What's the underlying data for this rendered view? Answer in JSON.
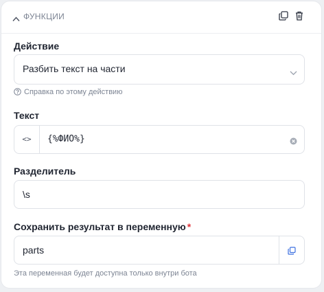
{
  "section": {
    "title": "ФУНКЦИИ"
  },
  "action": {
    "label": "Действие",
    "value": "Разбить текст на части",
    "help": "Справка по этому действию"
  },
  "text": {
    "label": "Текст",
    "code_toggle": "<>",
    "value": "{%ФИО%}"
  },
  "separator": {
    "label": "Разделитель",
    "value": "\\s"
  },
  "result": {
    "label": "Сохранить результат в переменную",
    "required_mark": "*",
    "value": "parts",
    "note": "Эта переменная будет доступна только внутри бота"
  },
  "colors": {
    "accent": "#3b6fe0",
    "required": "#e0353b",
    "muted": "#7c8493"
  },
  "icons": [
    "chevron-up-icon",
    "copy-icon",
    "trash-icon",
    "chevron-down-icon",
    "help-circle-icon",
    "clear-icon",
    "copy-icon"
  ]
}
